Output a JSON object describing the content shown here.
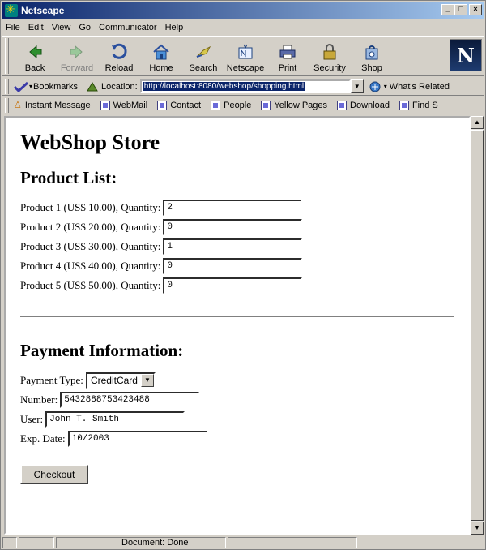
{
  "window": {
    "title": "Netscape",
    "min": "_",
    "max": "□",
    "close": "×"
  },
  "menu": [
    {
      "label": "File"
    },
    {
      "label": "Edit"
    },
    {
      "label": "View"
    },
    {
      "label": "Go"
    },
    {
      "label": "Communicator"
    },
    {
      "label": "Help"
    }
  ],
  "toolbar": [
    {
      "label": "Back",
      "icon": "back-arrow-icon",
      "enabled": true
    },
    {
      "label": "Forward",
      "icon": "forward-arrow-icon",
      "enabled": false
    },
    {
      "label": "Reload",
      "icon": "reload-icon",
      "enabled": true
    },
    {
      "label": "Home",
      "icon": "home-icon",
      "enabled": true
    },
    {
      "label": "Search",
      "icon": "search-icon",
      "enabled": true
    },
    {
      "label": "Netscape",
      "icon": "netscape-icon",
      "enabled": true
    },
    {
      "label": "Print",
      "icon": "print-icon",
      "enabled": true
    },
    {
      "label": "Security",
      "icon": "lock-icon",
      "enabled": true
    },
    {
      "label": "Shop",
      "icon": "shop-icon",
      "enabled": true
    }
  ],
  "brand_letter": "N",
  "location": {
    "bookmarks_label": "Bookmarks",
    "label": "Location:",
    "url": "http://localhost:8080/webshop/shopping.html",
    "related_label": "What's Related"
  },
  "personal": [
    {
      "label": "Instant Message"
    },
    {
      "label": "WebMail"
    },
    {
      "label": "Contact"
    },
    {
      "label": "People"
    },
    {
      "label": "Yellow Pages"
    },
    {
      "label": "Download"
    },
    {
      "label": "Find S"
    }
  ],
  "page": {
    "title": "WebShop Store",
    "product_heading": "Product List:",
    "products": [
      {
        "label": "Product 1 (US$ 10.00), Quantity:",
        "qty": "2"
      },
      {
        "label": "Product 2 (US$ 20.00), Quantity:",
        "qty": "0"
      },
      {
        "label": "Product 3 (US$ 30.00), Quantity:",
        "qty": "1"
      },
      {
        "label": "Product 4 (US$ 40.00), Quantity:",
        "qty": "0"
      },
      {
        "label": "Product 5 (US$ 50.00), Quantity:",
        "qty": "0"
      }
    ],
    "payment_heading": "Payment Information:",
    "payment_type_label": "Payment Type:",
    "payment_type_value": "CreditCard",
    "number_label": "Number:",
    "number_value": "5432888753423488",
    "user_label": "User:",
    "user_value": "John T. Smith",
    "exp_label": "Exp. Date:",
    "exp_value": "10/2003",
    "checkout_label": "Checkout"
  },
  "status": {
    "text": "Document: Done"
  },
  "colors": {
    "title_bar_start": "#0a246a",
    "title_bar_end": "#a6caf0",
    "chrome": "#d4d0c8"
  }
}
